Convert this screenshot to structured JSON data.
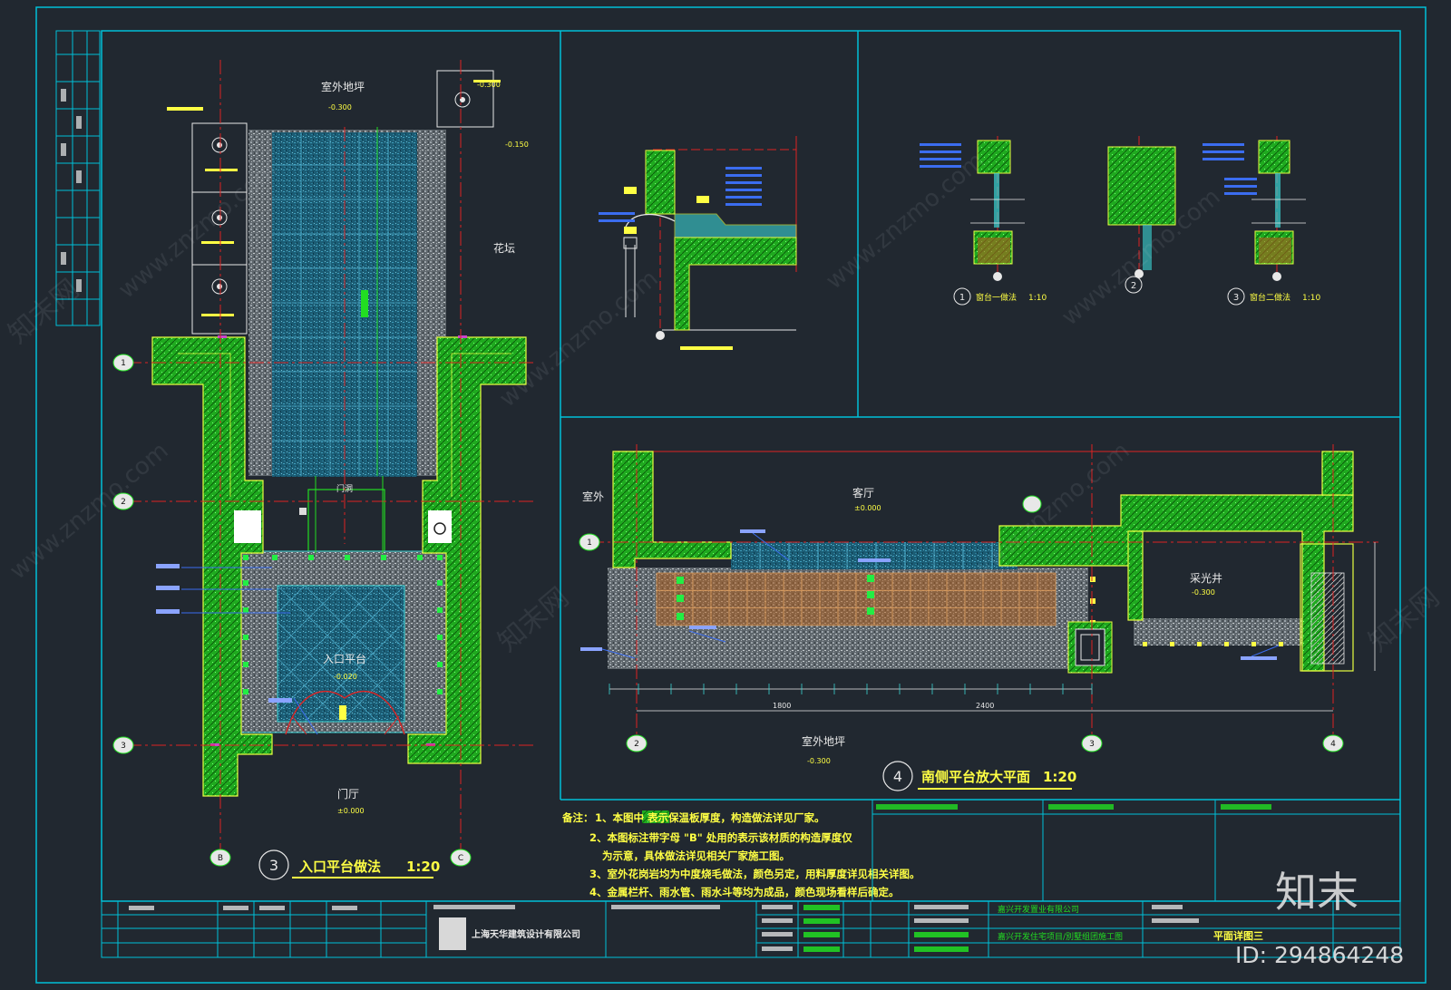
{
  "drawing": {
    "plan3": {
      "title": "入口平台做法",
      "scale": "1:20",
      "number": "3",
      "labels": {
        "outdoor_ground": "室外地坪",
        "flower_bed": "花坛",
        "entry_platform": "入口平台",
        "hall": "门厅",
        "door_opening": "门洞"
      },
      "levels": {
        "outdoor_ground": "-0.300",
        "entry_platform": "-0.020",
        "hall": "±0.000",
        "top_right": "-0.150",
        "right_small": "-0.300"
      },
      "grid": [
        "1",
        "2",
        "3",
        "B",
        "C"
      ]
    },
    "plan4": {
      "title": "南侧平台放大平面",
      "scale": "1:20",
      "number": "4",
      "labels": {
        "outdoor": "室外",
        "living_room": "客厅",
        "lightwell": "采光井",
        "outdoor_ground": "室外地坪"
      },
      "levels": {
        "living_room": "±0.000",
        "lightwell": "-0.300",
        "outdoor_ground": "-0.300"
      },
      "grid": [
        "1",
        "2",
        "3",
        "4"
      ],
      "dims": [
        "1800",
        "2400"
      ]
    },
    "details": {
      "d1": {
        "num": "1",
        "title": "窗台一做法",
        "scale": "1:10"
      },
      "d2": {
        "num": "2"
      },
      "d3": {
        "num": "3",
        "title": "窗台二做法",
        "scale": "1:10"
      }
    },
    "notes": {
      "lead": "备注：",
      "items": [
        "1、本图中        表示保温板厚度，构造做法详见厂家。",
        "2、本图标注带字母 \"B\" 处用的表示该材质的构造厚度仅",
        "为示意，具体做法详见相关厂家施工图。",
        "3、室外花岗岩均为中度烧毛做法，颜色另定，用料厚度详见相关详图。",
        "4、金属栏杆、雨水管、雨水斗等均为成品，颜色现场看样后确定。"
      ]
    },
    "titleblock": {
      "company": "上海天华建筑设计有限公司",
      "client": "嘉兴开发置业有限公司",
      "project": "嘉兴开发住宅项目/別墅组团施工图",
      "sheet_name": "平面详图三"
    }
  },
  "watermark": {
    "brand": "知末",
    "site": "www.znzmo.com",
    "site_cn": "知末网",
    "id": "ID: 294864248"
  },
  "colors": {
    "background": "#212830",
    "frame": "#00c0d8",
    "wall": "#22dd22",
    "wall_border": "#e8ff40",
    "axis": "#dd2222",
    "text_yellow": "#ffff44",
    "text_white": "#e8e8e8",
    "tile_blue": "#1a6a86",
    "granite": "#7a8288",
    "brick": "#b06020"
  }
}
